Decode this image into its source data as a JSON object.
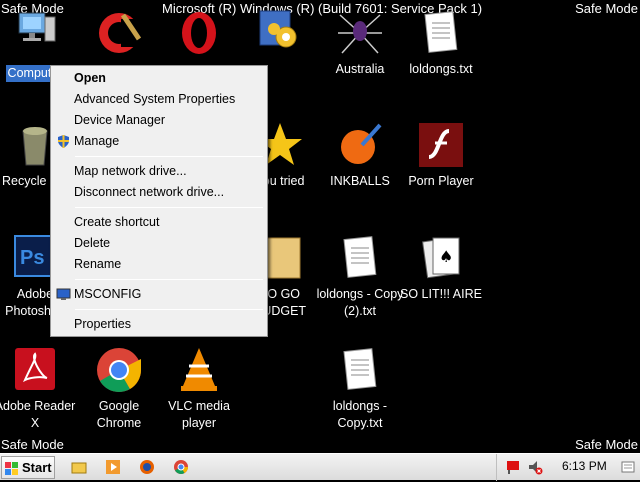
{
  "safe_mode": {
    "top_left": "Safe Mode",
    "top_right": "Safe Mode",
    "bottom_left": "Safe Mode",
    "bottom_right": "Safe Mode"
  },
  "build_text": "Microsoft (R) Windows (R) (Build 7601: Service Pack 1)",
  "desktop_icons": [
    {
      "label": "Computer",
      "icon": "computer-icon"
    },
    {
      "label": "CCleaner",
      "icon": "ccleaner-icon"
    },
    {
      "label": "Opera",
      "icon": "opera-icon"
    },
    {
      "label": "WinUtilities",
      "icon": "winutilities-icon"
    },
    {
      "label": "Australia",
      "icon": "spider-icon"
    },
    {
      "label": "loldongs.txt",
      "icon": "text-file-icon"
    },
    {
      "label": "Recycle Bin",
      "icon": "recycle-bin-icon"
    },
    {
      "label": "You tried",
      "icon": "star-icon"
    },
    {
      "label": "INKBALLS",
      "icon": "inkball-icon"
    },
    {
      "label": "Porn Player",
      "icon": "flash-icon"
    },
    {
      "label": "Adobe Photoshop",
      "icon": "photoshop-icon"
    },
    {
      "label": "TO GO BUDGET",
      "icon": "folder-icon"
    },
    {
      "label": "loldongs - Copy (2).txt",
      "icon": "text-file-icon"
    },
    {
      "label": "SO LIT!!! AIRE",
      "icon": "cards-icon"
    },
    {
      "label": "Adobe Reader X",
      "icon": "adobe-reader-icon"
    },
    {
      "label": "Google Chrome",
      "icon": "chrome-icon"
    },
    {
      "label": "VLC media player",
      "icon": "vlc-icon"
    },
    {
      "label": "loldongs - Copy.txt",
      "icon": "text-file-icon"
    }
  ],
  "context_menu": {
    "items": [
      {
        "label": "Open"
      },
      {
        "label": "Advanced System Properties"
      },
      {
        "label": "Device Manager"
      },
      {
        "label": "Manage",
        "icon": "shield-icon"
      },
      {
        "label": "Map network drive..."
      },
      {
        "label": "Disconnect network drive..."
      },
      {
        "label": "Create shortcut"
      },
      {
        "label": "Delete"
      },
      {
        "label": "Rename"
      },
      {
        "label": "MSCONFIG",
        "icon": "monitor-icon"
      },
      {
        "label": "Properties"
      }
    ]
  },
  "taskbar": {
    "start_label": "Start",
    "pinned": [
      "explorer-icon",
      "media-player-icon",
      "firefox-icon",
      "chrome-icon"
    ],
    "tray_icons": [
      "flag-icon",
      "volume-muted-icon"
    ],
    "clock": "6:13 PM",
    "show_desktop": "show-desktop-icon"
  },
  "colors": {
    "desktop": "#000000",
    "selection": "#3470c8",
    "menu_bg": "#f0f0f0"
  }
}
